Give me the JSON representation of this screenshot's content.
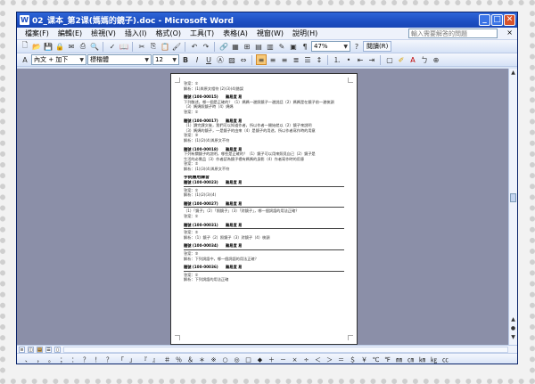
{
  "window": {
    "title": "02_课本_第2课(媽媽的鏡子).doc - Microsoft Word",
    "controls": {
      "minimize": "_",
      "maximize": "□",
      "close": "✕"
    }
  },
  "menu": {
    "items": [
      "檔案(F)",
      "編輯(E)",
      "檢視(V)",
      "插入(I)",
      "格式(O)",
      "工具(T)",
      "表格(A)",
      "視窗(W)",
      "說明(H)"
    ],
    "help_placeholder": "輸入需要解答的問題",
    "close_label": "×"
  },
  "standard_toolbar": {
    "zoom": "47%",
    "read_label": "閱讀(R)"
  },
  "format_toolbar": {
    "style": "內文 + 加下",
    "font": "標楷體",
    "size": "12",
    "bold": "B",
    "italic": "I",
    "underline": "U"
  },
  "document": {
    "lines": [
      {
        "t": "答案：①",
        "k": ""
      },
      {
        "t": "解析：(1)與原文相符 (2)(3)(4)錯誤",
        "k": ""
      },
      {
        "t": "",
        "k": "gap"
      },
      {
        "t": "題號 (100-00015)　　難易度 易",
        "k": "q"
      },
      {
        "t": "下列敘述，哪一個是正確的？（1）媽媽一邊照鏡子一邊說話（2）媽媽是在鏡子前一邊梳頭",
        "k": ""
      },
      {
        "t": "（3）媽媽照鏡子時（4）媽媽",
        "k": ""
      },
      {
        "t": "答案：①",
        "k": ""
      },
      {
        "t": "",
        "k": "gap"
      },
      {
        "t": "題號 (100-00017)　　難易度 易",
        "k": "q"
      },
      {
        "t": "（1）讀完課文後，我們可以知道作者，所以作者一開始就以（2）鏡子來說明",
        "k": ""
      },
      {
        "t": "（3）媽媽的鏡子，一是鏡子的由來（4）是鏡子的用途，所以作者寫作時的用意",
        "k": ""
      },
      {
        "t": "答案：③",
        "k": ""
      },
      {
        "t": "解析：(1)(2)(4)與原文不符",
        "k": ""
      },
      {
        "t": "",
        "k": "gap"
      },
      {
        "t": "題號 (100-00018)　　難易度 易",
        "k": "q"
      },
      {
        "t": "下列有關鏡子的說明，哪些是正確的？（1）鏡子可以用來照見自己（2）鏡子是",
        "k": ""
      },
      {
        "t": "生活的必需品（3）作者認為鏡子裡有媽媽的身影（4）作者寫作時的用意",
        "k": ""
      },
      {
        "t": "答案：②",
        "k": ""
      },
      {
        "t": "解析：(1)(3)(4)與原文不符",
        "k": ""
      },
      {
        "t": "",
        "k": "gap"
      },
      {
        "t": "字詞應用練習",
        "k": "h"
      },
      {
        "t": "題號 (100-00023)　　難易度 易",
        "k": "q"
      },
      {
        "t": "",
        "k": "rule"
      },
      {
        "t": "答案：①",
        "k": ""
      },
      {
        "t": "解析：(1)(2)(3)(4)",
        "k": ""
      },
      {
        "t": "",
        "k": "gap"
      },
      {
        "t": "題號 (100-00027)　　難易度 易",
        "k": "q"
      },
      {
        "t": "",
        "k": "rule"
      },
      {
        "t": "（1）「鏡子」（2）「照鏡子」（3）「對鏡子」，哪一個詞語的用法正確？",
        "k": ""
      },
      {
        "t": "答案：①",
        "k": ""
      },
      {
        "t": "",
        "k": "gap"
      },
      {
        "t": "題號 (100-00031)　　難易度 易",
        "k": "q"
      },
      {
        "t": "",
        "k": "rule"
      },
      {
        "t": "答案：②",
        "k": ""
      },
      {
        "t": "解析：（1）鏡子（2）照鏡子（3）對鏡子（4）梳頭",
        "k": ""
      },
      {
        "t": "",
        "k": "gap"
      },
      {
        "t": "題號 (100-00034)　　難易度 易",
        "k": "q"
      },
      {
        "t": "",
        "k": "rule"
      },
      {
        "t": "答案：③",
        "k": ""
      },
      {
        "t": "解析：下列詞語中，哪一個詞語的用法正確？",
        "k": ""
      },
      {
        "t": "",
        "k": "gap"
      },
      {
        "t": "題號 (100-00036)　　難易度 易",
        "k": "q"
      },
      {
        "t": "",
        "k": "rule"
      },
      {
        "t": "答案：①",
        "k": ""
      },
      {
        "t": "解析：下列詞語的用法正確",
        "k": ""
      }
    ]
  },
  "symbols": [
    "、",
    "，",
    "。",
    "；",
    "：",
    "？",
    "！",
    "？",
    "「",
    "」",
    "『",
    "』",
    "＃",
    "％",
    "＆",
    "＊",
    "※",
    "○",
    "◎",
    "□",
    "◆",
    "＋",
    "－",
    "×",
    "÷",
    "＜",
    "＞",
    "＝",
    "＄",
    "￥",
    "℃",
    "℉",
    "㎜",
    "㎝",
    "㎞",
    "㎏",
    "㏄"
  ]
}
